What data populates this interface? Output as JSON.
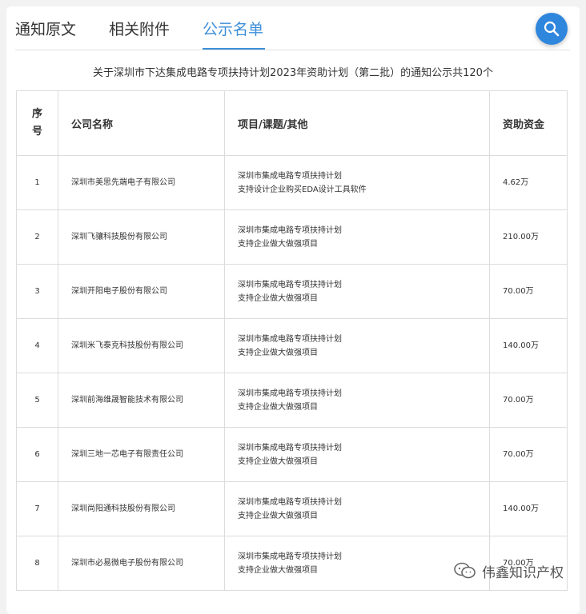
{
  "tabs": [
    {
      "label": "通知原文"
    },
    {
      "label": "相关附件"
    },
    {
      "label": "公示名单"
    }
  ],
  "active_tab": "公示名单",
  "search": {
    "icon": "search-icon"
  },
  "notice": "关于深圳市下达集成电路专项扶持计划2023年资助计划（第二批）的通知公示共120个",
  "table": {
    "headers": {
      "no": "序号",
      "company": "公司名称",
      "project": "项目/课题/其他",
      "amount": "资助资金"
    },
    "rows": [
      {
        "no": "1",
        "company": "深圳市美思先端电子有限公司",
        "project_line1": "深圳市集成电路专项扶持计划",
        "project_line2": "支持设计企业购买EDA设计工具软件",
        "amount": "4.62万"
      },
      {
        "no": "2",
        "company": "深圳飞骧科技股份有限公司",
        "project_line1": "深圳市集成电路专项扶持计划",
        "project_line2": "支持企业做大做强项目",
        "amount": "210.00万"
      },
      {
        "no": "3",
        "company": "深圳开阳电子股份有限公司",
        "project_line1": "深圳市集成电路专项扶持计划",
        "project_line2": "支持企业做大做强项目",
        "amount": "70.00万"
      },
      {
        "no": "4",
        "company": "深圳米飞泰克科技股份有限公司",
        "project_line1": "深圳市集成电路专项扶持计划",
        "project_line2": "支持企业做大做强项目",
        "amount": "140.00万"
      },
      {
        "no": "5",
        "company": "深圳前海维晟智能技术有限公司",
        "project_line1": "深圳市集成电路专项扶持计划",
        "project_line2": "支持企业做大做强项目",
        "amount": "70.00万"
      },
      {
        "no": "6",
        "company": "深圳三地一芯电子有限责任公司",
        "project_line1": "深圳市集成电路专项扶持计划",
        "project_line2": "支持企业做大做强项目",
        "amount": "70.00万"
      },
      {
        "no": "7",
        "company": "深圳尚阳通科技股份有限公司",
        "project_line1": "深圳市集成电路专项扶持计划",
        "project_line2": "支持企业做大做强项目",
        "amount": "140.00万"
      },
      {
        "no": "8",
        "company": "深圳市必易微电子股份有限公司",
        "project_line1": "深圳市集成电路专项扶持计划",
        "project_line2": "支持企业做大做强项目",
        "amount": "70.00万"
      }
    ]
  },
  "watermark": {
    "icon": "wechat-icon",
    "text": "伟鑫知识产权"
  },
  "colors": {
    "accent": "#3c8ed8",
    "search_button": "#2f86dd",
    "border": "#dcdcdc"
  }
}
